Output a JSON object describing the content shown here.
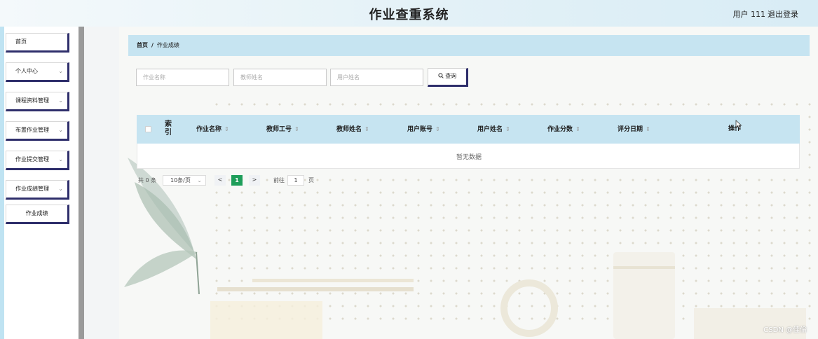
{
  "header": {
    "title": "作业查重系统",
    "user": "用户 111",
    "logout": "退出登录"
  },
  "sidebar": {
    "items": [
      {
        "label": "首页",
        "has_arrow": false
      },
      {
        "label": "个人中心",
        "has_arrow": true
      },
      {
        "label": "课程资料管理",
        "has_arrow": true
      },
      {
        "label": "布置作业管理",
        "has_arrow": true
      },
      {
        "label": "作业提交管理",
        "has_arrow": true
      },
      {
        "label": "作业成绩管理",
        "has_arrow": true
      },
      {
        "label": "作业成绩",
        "has_arrow": false
      }
    ],
    "arrow_glyph": "⌄"
  },
  "breadcrumb": {
    "home": "首页",
    "separator": "/",
    "current": "作业成绩"
  },
  "search": {
    "field1_placeholder": "作业名称",
    "field2_placeholder": "教师姓名",
    "field3_placeholder": "用户姓名",
    "button_label": "查询",
    "button_icon": "search-icon"
  },
  "table": {
    "index_header": "索引",
    "sort_glyph": "⇕",
    "columns": [
      "作业名称",
      "教师工号",
      "教师姓名",
      "用户账号",
      "用户姓名",
      "作业分数",
      "评分日期"
    ],
    "action_header": "操作",
    "empty_text": "暂无数据"
  },
  "pagination": {
    "total": "共 0 条",
    "page_size": "10条/页",
    "prev": "<",
    "current_page": "1",
    "next": ">",
    "goto_label": "前往",
    "goto_value": "1",
    "page_suffix": "页"
  },
  "watermark": "CSDN @佳倫",
  "colors": {
    "header_bg": "#e3f1f7",
    "breadcrumb_bg": "#c6e4f1",
    "table_head_bg": "#c6e4f1",
    "active_page": "#1e9e5a",
    "button_shadow": "#2e2e6b"
  }
}
